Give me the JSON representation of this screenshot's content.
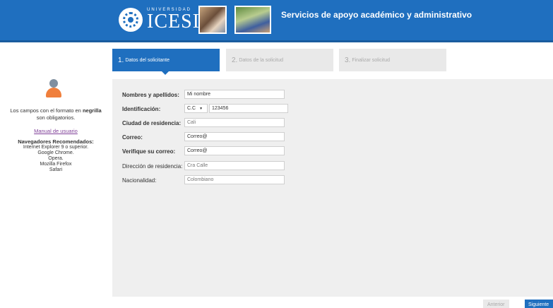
{
  "header": {
    "logo_small": "UNIVERSIDAD",
    "logo_big": "ICESI",
    "title": "Servicios de apoyo académico y administrativo",
    "brand_color": "#1f6fbf"
  },
  "steps": [
    {
      "num": "1.",
      "label": "Datos del solicitante",
      "active": true
    },
    {
      "num": "2.",
      "label": "Datos de la solicitud",
      "active": false
    },
    {
      "num": "3.",
      "label": "Finalizar solicitud",
      "active": false
    }
  ],
  "sidebar": {
    "required_text_prefix": "Los campos con el formato en ",
    "required_text_bold": "negrilla",
    "required_text_suffix": "son obligatorios.",
    "manual_link": "Manual de usuario",
    "browsers_title": "Navegadores Recomendados:",
    "browsers": [
      "Internet Explorer 9 o superior.",
      "Google Chrome.",
      "Opera.",
      "Mozilla Firefox",
      "Safari"
    ]
  },
  "form": {
    "name_label": "Nombres y apellidos:",
    "name_value": "Mi nombre",
    "id_label": "Identificación:",
    "id_type": "C.C",
    "id_value": "123456",
    "city_label": "Ciudad de residencia:",
    "city_value": "Cali",
    "email_label": "Correo:",
    "email_value": "Correo@",
    "email_confirm_label": "Verifique su correo:",
    "email_confirm_value": "Correo@",
    "address_label": "Dirección de residencia:",
    "address_value": "Cra Calle",
    "nationality_label": "Nacionalidad:",
    "nationality_value": "Colombiano"
  },
  "buttons": {
    "prev_label": "Anterior",
    "next_label": "Siguiente"
  }
}
